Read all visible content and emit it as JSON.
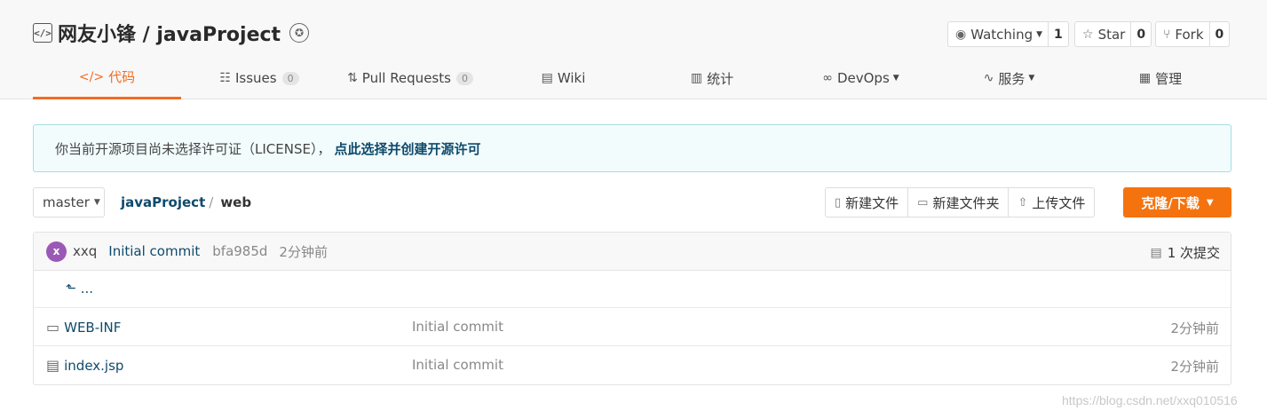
{
  "repo": {
    "owner": "网友小锋",
    "separator": " / ",
    "name": "javaProject",
    "icon": "code-repo-icon",
    "badge_icon": "recommend-badge-icon"
  },
  "actions": {
    "watching_label": "Watching",
    "watching_count": "1",
    "star_label": "Star",
    "star_count": "0",
    "fork_label": "Fork",
    "fork_count": "0"
  },
  "tabs": [
    {
      "label": "代码",
      "icon": "code-icon",
      "active": true
    },
    {
      "label": "Issues",
      "count": "0",
      "icon": "issues-icon"
    },
    {
      "label": "Pull Requests",
      "count": "0",
      "icon": "pull-request-icon"
    },
    {
      "label": "Wiki",
      "icon": "book-icon"
    },
    {
      "label": "统计",
      "icon": "bar-chart-icon"
    },
    {
      "label": "DevOps",
      "icon": "infinity-icon",
      "dropdown": true
    },
    {
      "label": "服务",
      "icon": "pulse-icon",
      "dropdown": true
    },
    {
      "label": "管理",
      "icon": "settings-doc-icon"
    }
  ],
  "notice": {
    "text": "你当前开源项目尚未选择许可证（LICENSE），",
    "link": "点此选择并创建开源许可"
  },
  "branch": {
    "name": "master"
  },
  "breadcrumb": {
    "project": "javaProject",
    "sep": "/",
    "dir": "web"
  },
  "file_actions": {
    "new_file": "新建文件",
    "new_folder": "新建文件夹",
    "upload": "上传文件",
    "clone": "克隆/下载"
  },
  "last_commit": {
    "avatar_letter": "x",
    "user": "xxq",
    "message": "Initial commit",
    "hash": "bfa985d",
    "time": "2分钟前",
    "count_label": "1 次提交"
  },
  "up_dir": "...",
  "files": [
    {
      "name": "WEB-INF",
      "type": "folder",
      "message": "Initial commit",
      "time": "2分钟前"
    },
    {
      "name": "index.jsp",
      "type": "file",
      "message": "Initial commit",
      "time": "2分钟前"
    }
  ],
  "watermark": "https://blog.csdn.net/xxq010516",
  "colors": {
    "accent": "#f36c21",
    "clone_button": "#f5730f",
    "link": "#0f4a6b",
    "avatar": "#9b59b6",
    "notice_bg": "#f2fcfd"
  }
}
